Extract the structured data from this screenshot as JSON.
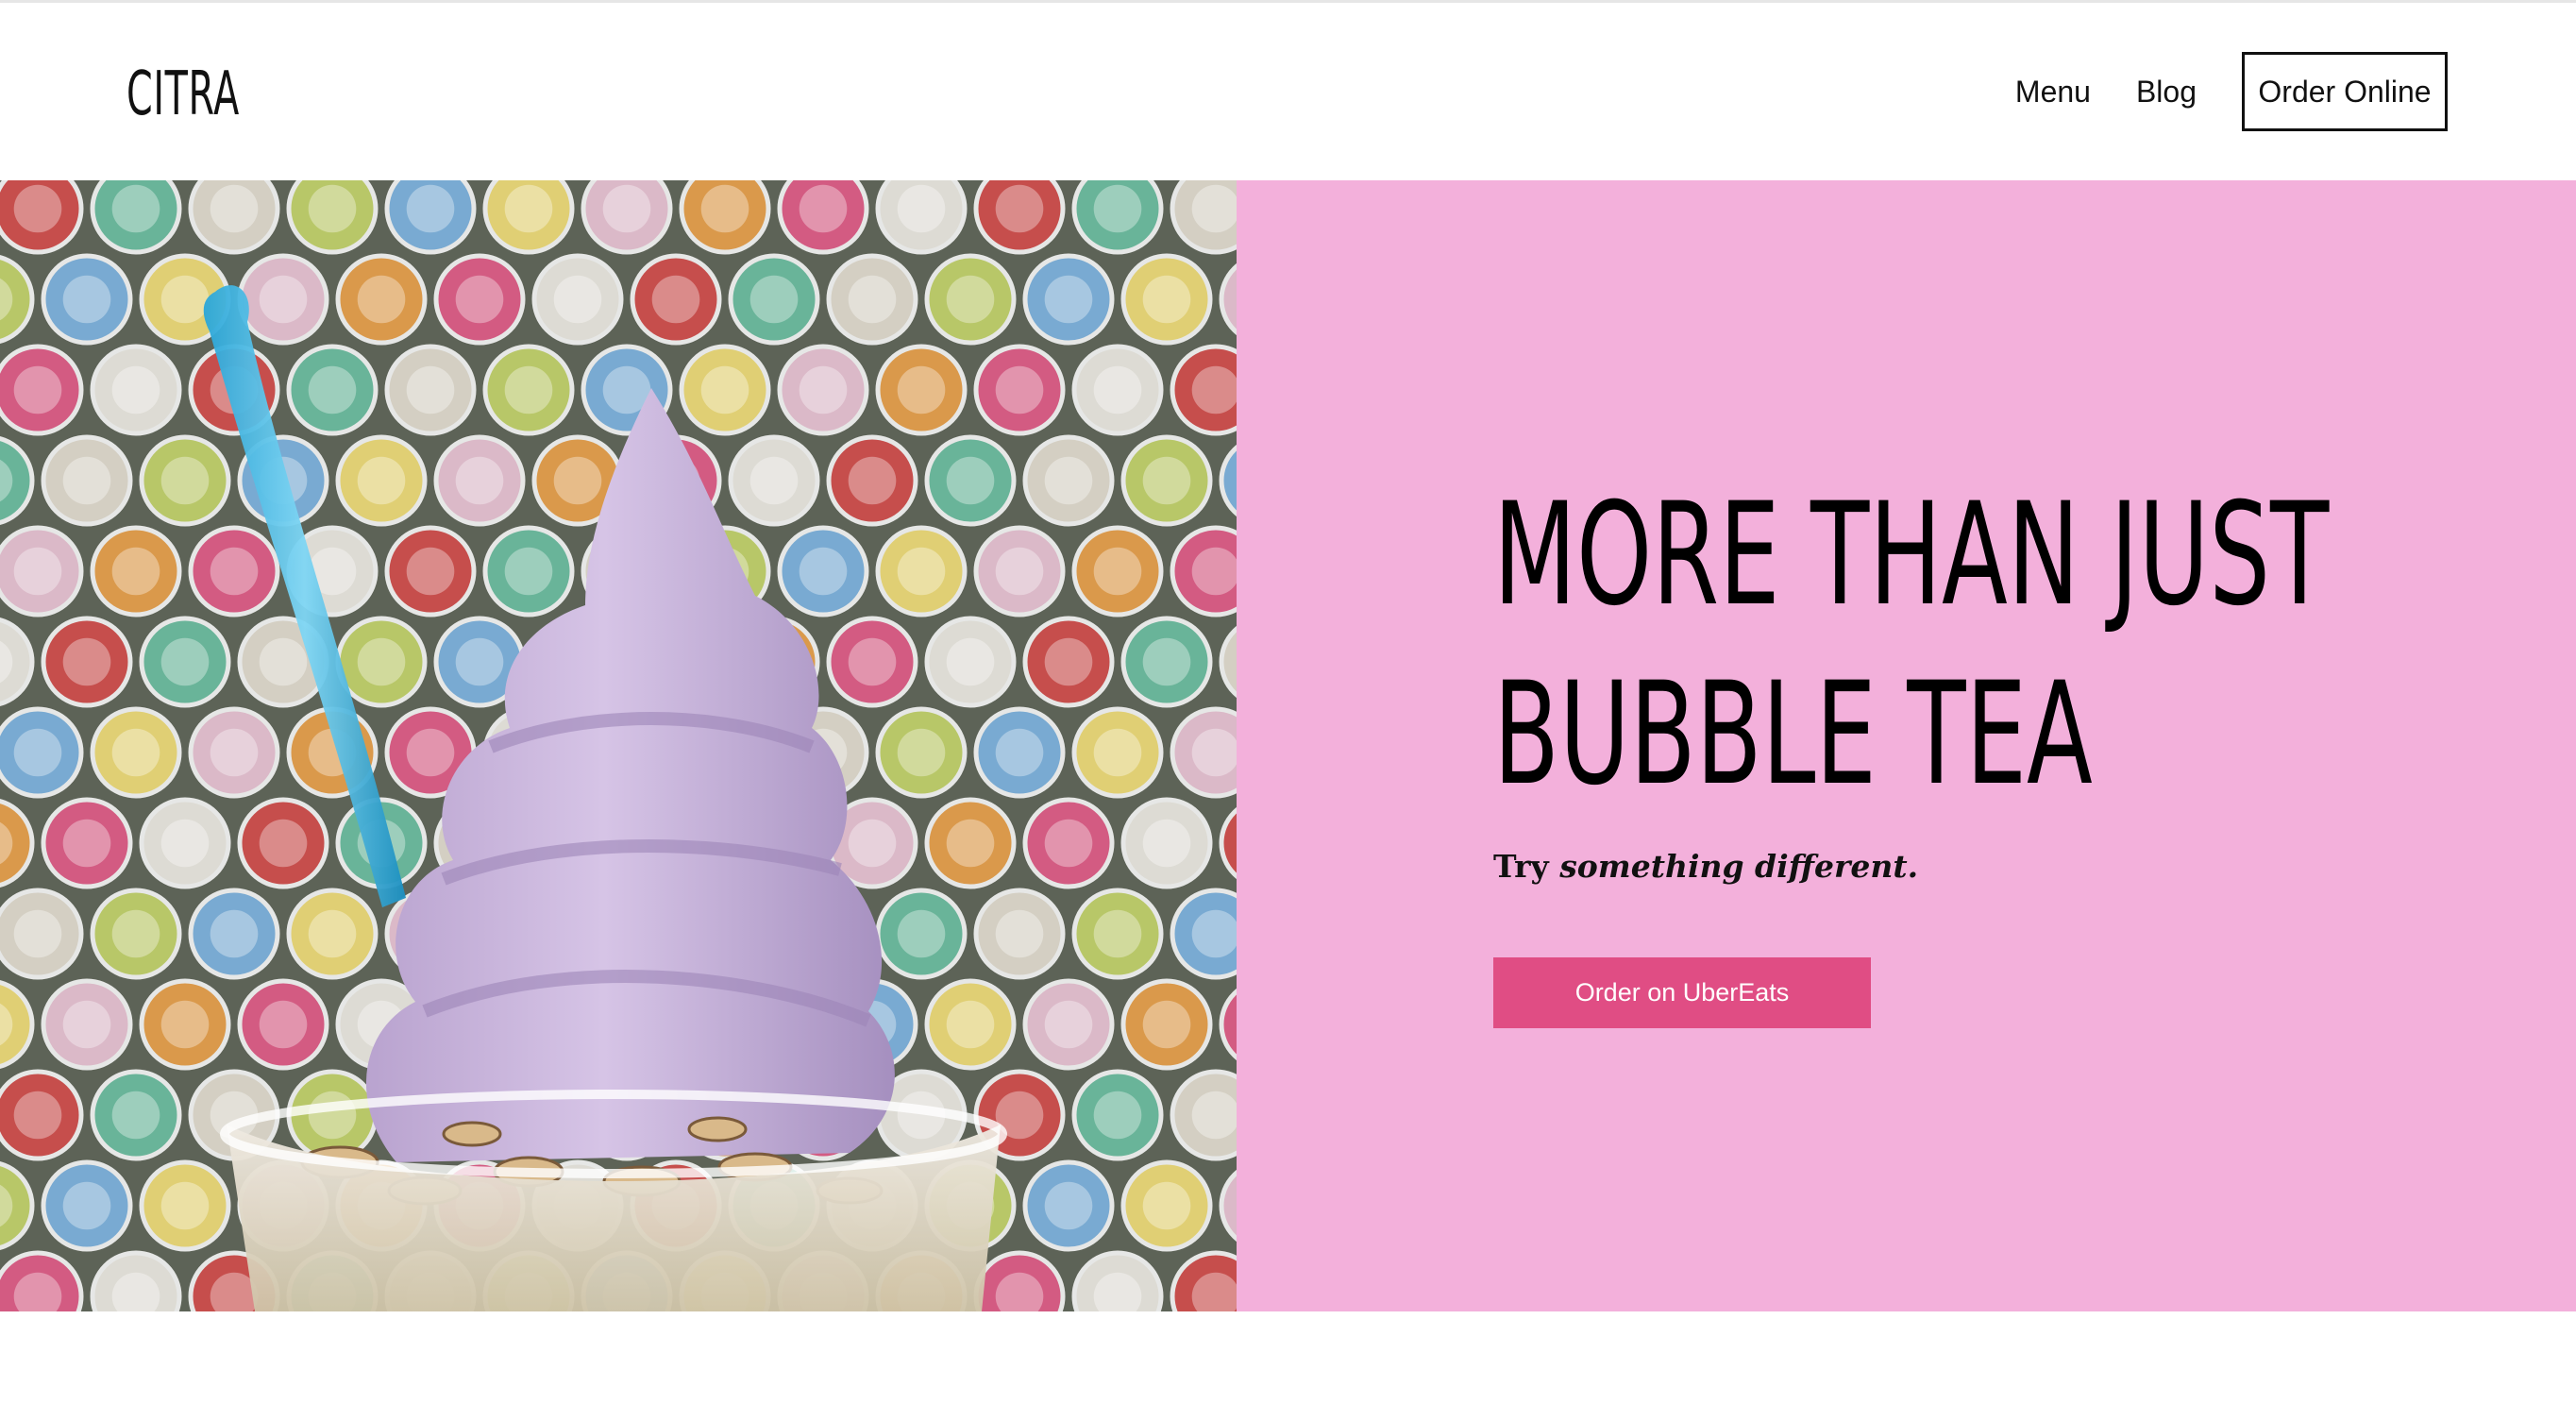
{
  "header": {
    "logo": "CITRA",
    "nav": [
      {
        "label": "Menu"
      },
      {
        "label": "Blog"
      }
    ],
    "order_button": "Order Online"
  },
  "hero": {
    "headline_line1": "MORE THAN JUST",
    "headline_line2": "BUBBLE TEA",
    "tagline_prefix": "Try ",
    "tagline_emphasis": "something different.",
    "cta_label": "Order on UberEats",
    "image_subject": "purple soft-serve swirl in a clear cup with a blue spoon, in front of a wall of colorful bottle caps"
  },
  "colors": {
    "panel_bg": "#f3b0db",
    "cta_bg": "#e04d84",
    "cta_text": "#ffffff",
    "text": "#111111"
  }
}
